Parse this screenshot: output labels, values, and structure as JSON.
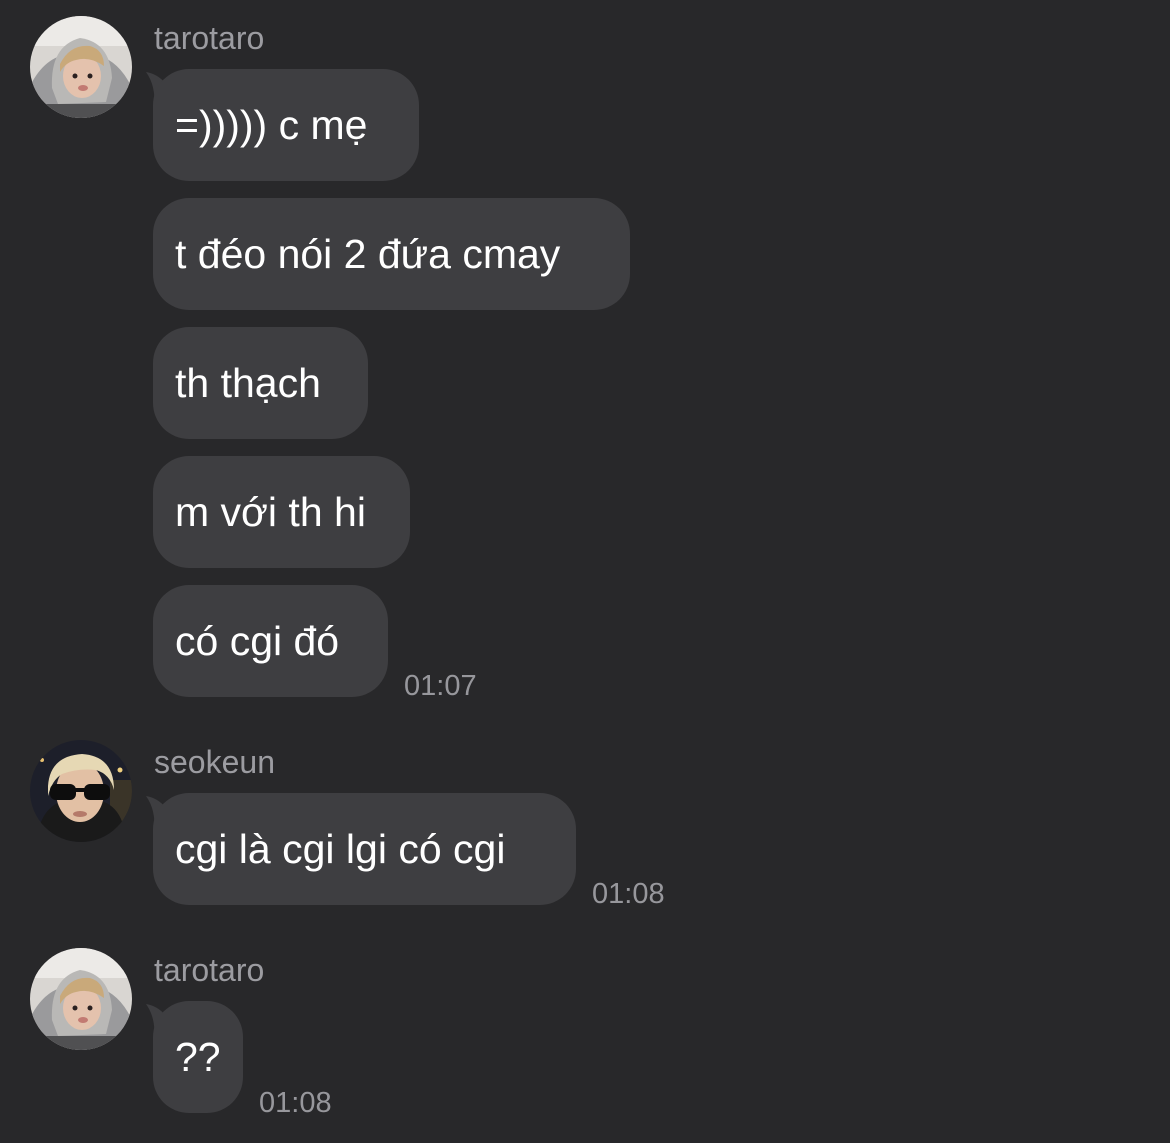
{
  "chat": {
    "groups": [
      {
        "sender": "tarotaro",
        "messages": [
          "=))))) c mẹ",
          "t đéo nói 2 đứa cmay",
          "th thạch",
          "m với th hi",
          "có cgi đó"
        ],
        "time": "01:07"
      },
      {
        "sender": "seokeun",
        "messages": [
          "cgi là cgi lgi có cgi"
        ],
        "time": "01:08"
      },
      {
        "sender": "tarotaro",
        "messages": [
          "??"
        ],
        "time": "01:08"
      }
    ]
  },
  "colors": {
    "background": "#28282a",
    "bubble": "#3e3e41",
    "message_text": "#ffffff",
    "meta_text": "#9c9ca1"
  },
  "icons": {
    "avatar_1": "profile-photo-hooded-person",
    "avatar_2": "profile-photo-person-sunglasses",
    "avatar_3": "profile-photo-hooded-person"
  }
}
